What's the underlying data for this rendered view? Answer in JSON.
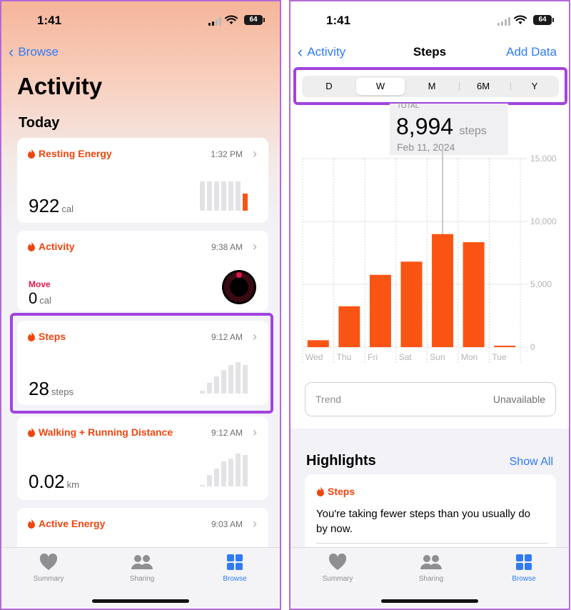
{
  "status": {
    "time": "1:41",
    "battery": "64"
  },
  "left": {
    "back_label": "Browse",
    "title": "Activity",
    "section": "Today",
    "cards": [
      {
        "title": "Resting Energy",
        "time": "1:32 PM",
        "value": "922",
        "unit": "cal",
        "bars": [
          0.85,
          0.85,
          0.85,
          0.85,
          0.85,
          0.85,
          0.5
        ]
      },
      {
        "title": "Activity",
        "time": "9:38 AM",
        "metric_label": "Move",
        "value": "0",
        "unit": "cal"
      },
      {
        "title": "Steps",
        "time": "9:12 AM",
        "value": "28",
        "unit": "steps",
        "bars": [
          0.1,
          0.35,
          0.55,
          0.75,
          0.9,
          1.0,
          0.9
        ]
      },
      {
        "title": "Walking + Running Distance",
        "time": "9:12 AM",
        "value": "0.02",
        "unit": "km",
        "bars": [
          0.05,
          0.35,
          0.55,
          0.75,
          0.85,
          1.0,
          0.95
        ]
      },
      {
        "title": "Active Energy",
        "time": "9:03 AM"
      }
    ]
  },
  "right": {
    "back_label": "Activity",
    "title": "Steps",
    "add_label": "Add Data",
    "segments": [
      "D",
      "W",
      "M",
      "6M",
      "Y"
    ],
    "selected_segment": "W",
    "total_label": "TOTAL",
    "total_value": "8,994",
    "total_unit": "steps",
    "total_date": "Feb 11, 2024",
    "trend_label": "Trend",
    "trend_value": "Unavailable",
    "highlights_title": "Highlights",
    "show_all": "Show All",
    "highlight_card_title": "Steps",
    "highlight_text": "You're taking fewer steps than you usually do by now."
  },
  "tabs": [
    {
      "label": "Summary",
      "icon": "heart-icon",
      "active": false
    },
    {
      "label": "Sharing",
      "icon": "people-icon",
      "active": false
    },
    {
      "label": "Browse",
      "icon": "grid-icon",
      "active": true
    }
  ],
  "colors": {
    "accent": "#fa5414",
    "link": "#2f7bf6",
    "highlight": "#a243df"
  },
  "chart_data": {
    "type": "bar",
    "categories": [
      "Wed",
      "Thu",
      "Fri",
      "Sat",
      "Sun",
      "Mon",
      "Tue"
    ],
    "series": [
      {
        "values": [
          550,
          3250,
          5750,
          6800,
          8994,
          8350,
          28
        ]
      }
    ],
    "ylim": [
      0,
      15000
    ],
    "yticks": [
      0,
      5000,
      10000,
      15000
    ],
    "ytick_labels": [
      "0",
      "5,000",
      "10,000",
      "15,000"
    ],
    "selected_category": "Sun",
    "grid": true
  }
}
